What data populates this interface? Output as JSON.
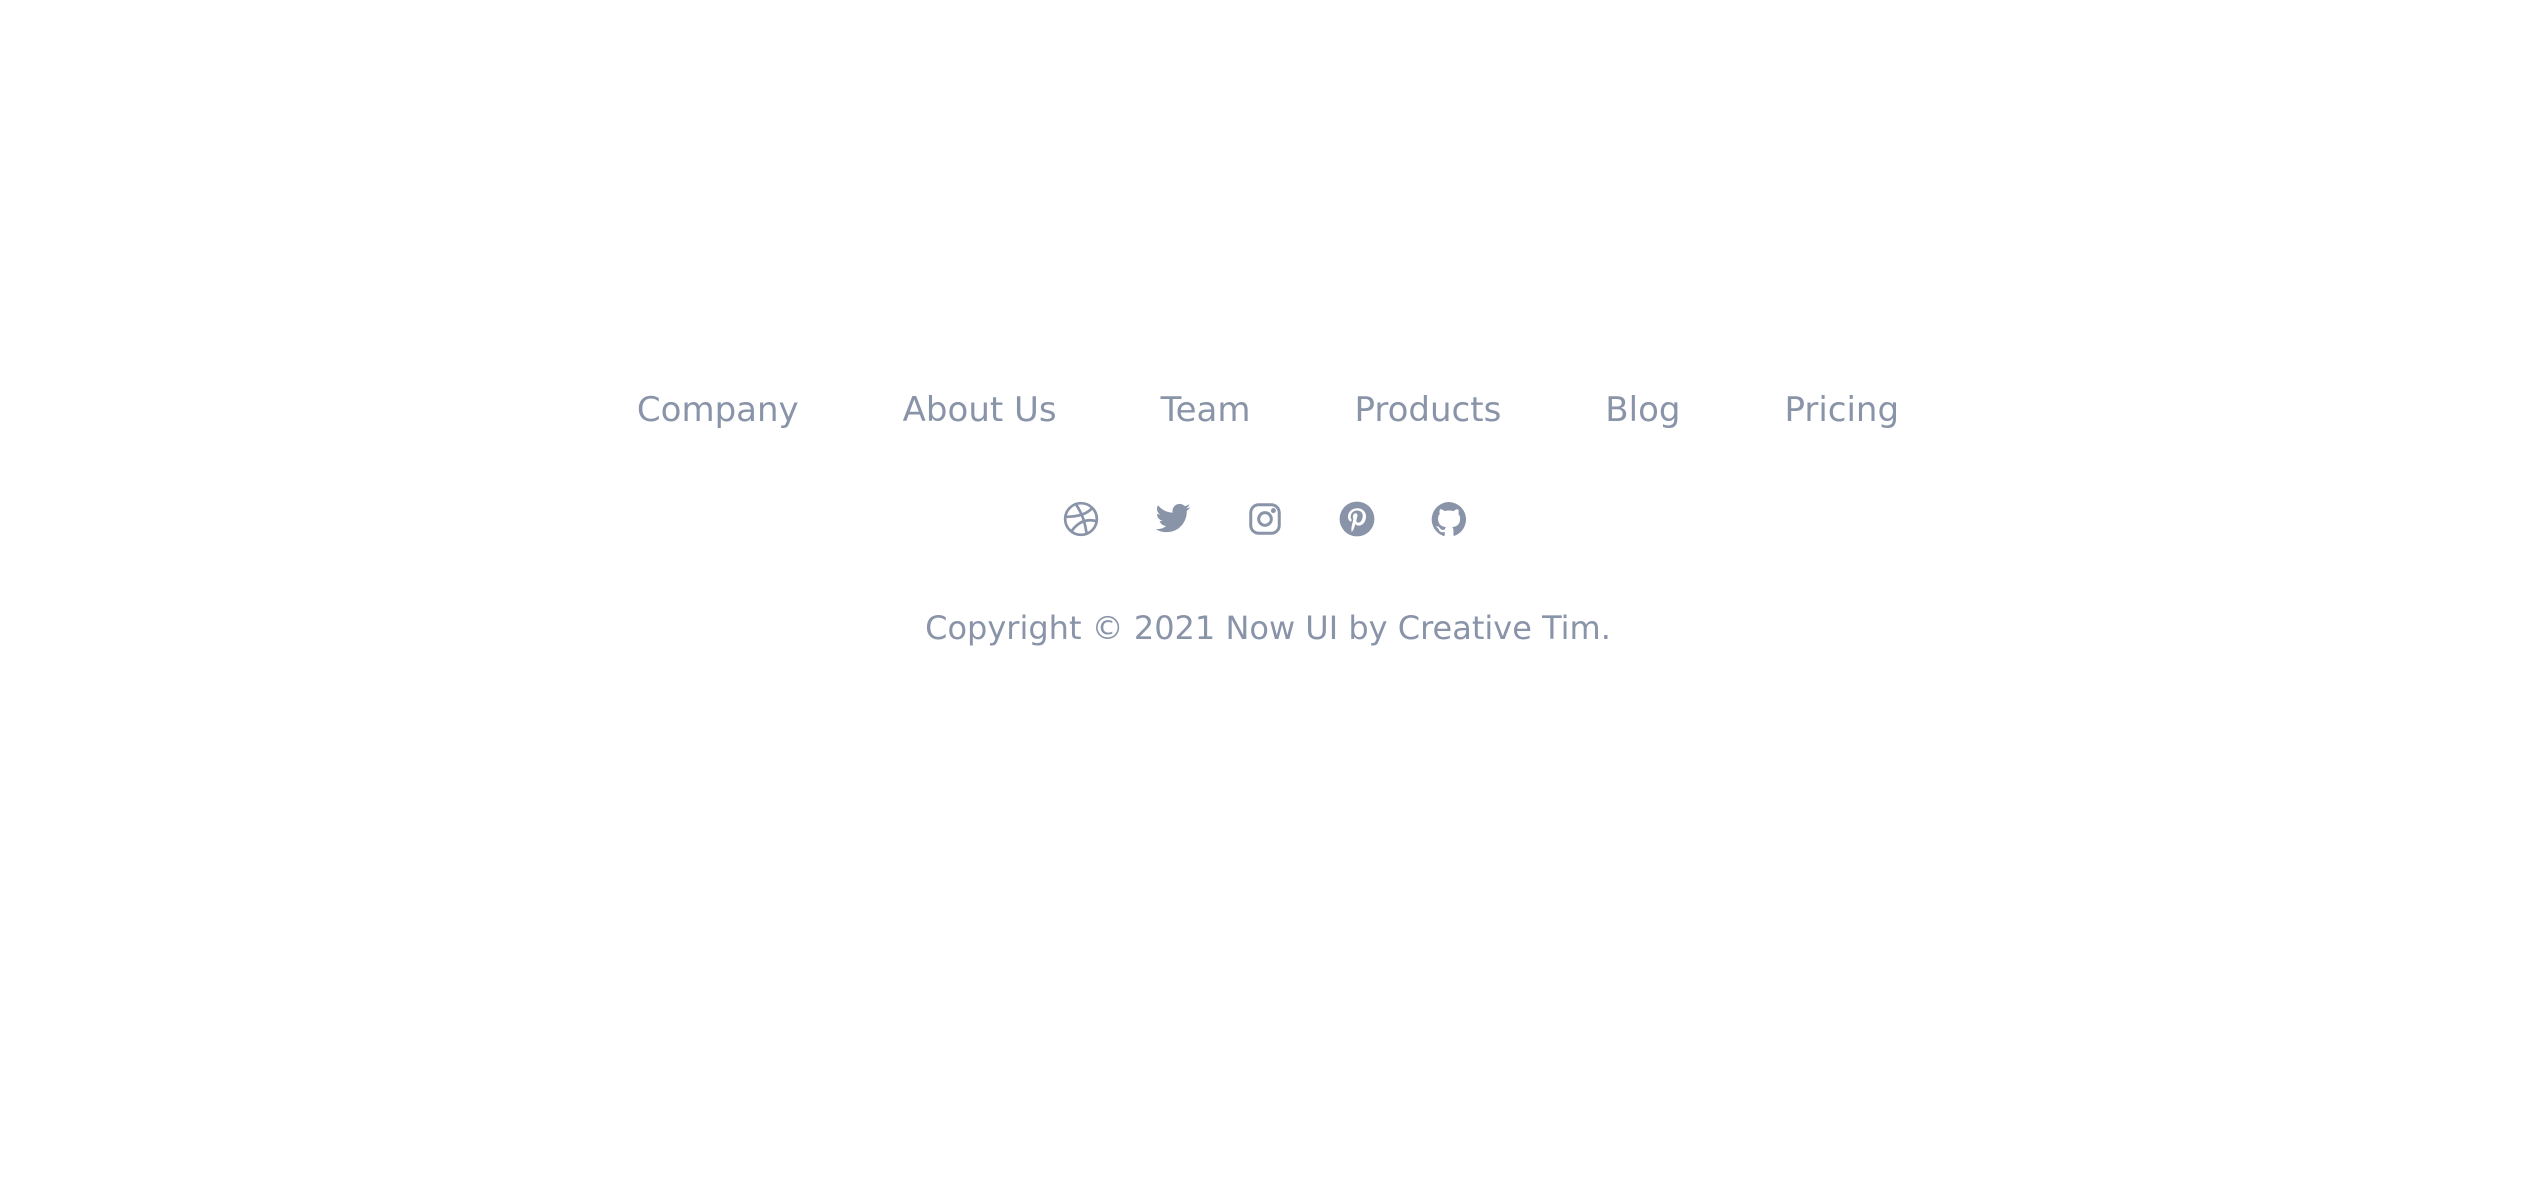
{
  "footer": {
    "nav": [
      {
        "label": "Company"
      },
      {
        "label": "About Us"
      },
      {
        "label": "Team"
      },
      {
        "label": "Products"
      },
      {
        "label": "Blog"
      },
      {
        "label": "Pricing"
      }
    ],
    "social": [
      {
        "icon": "dribbble-icon"
      },
      {
        "icon": "twitter-icon"
      },
      {
        "icon": "instagram-icon"
      },
      {
        "icon": "pinterest-icon"
      },
      {
        "icon": "github-icon"
      }
    ],
    "copyright": "Copyright © 2021 Now UI by Creative Tim."
  },
  "colors": {
    "text": "#8a94a8",
    "background": "#ffffff"
  }
}
